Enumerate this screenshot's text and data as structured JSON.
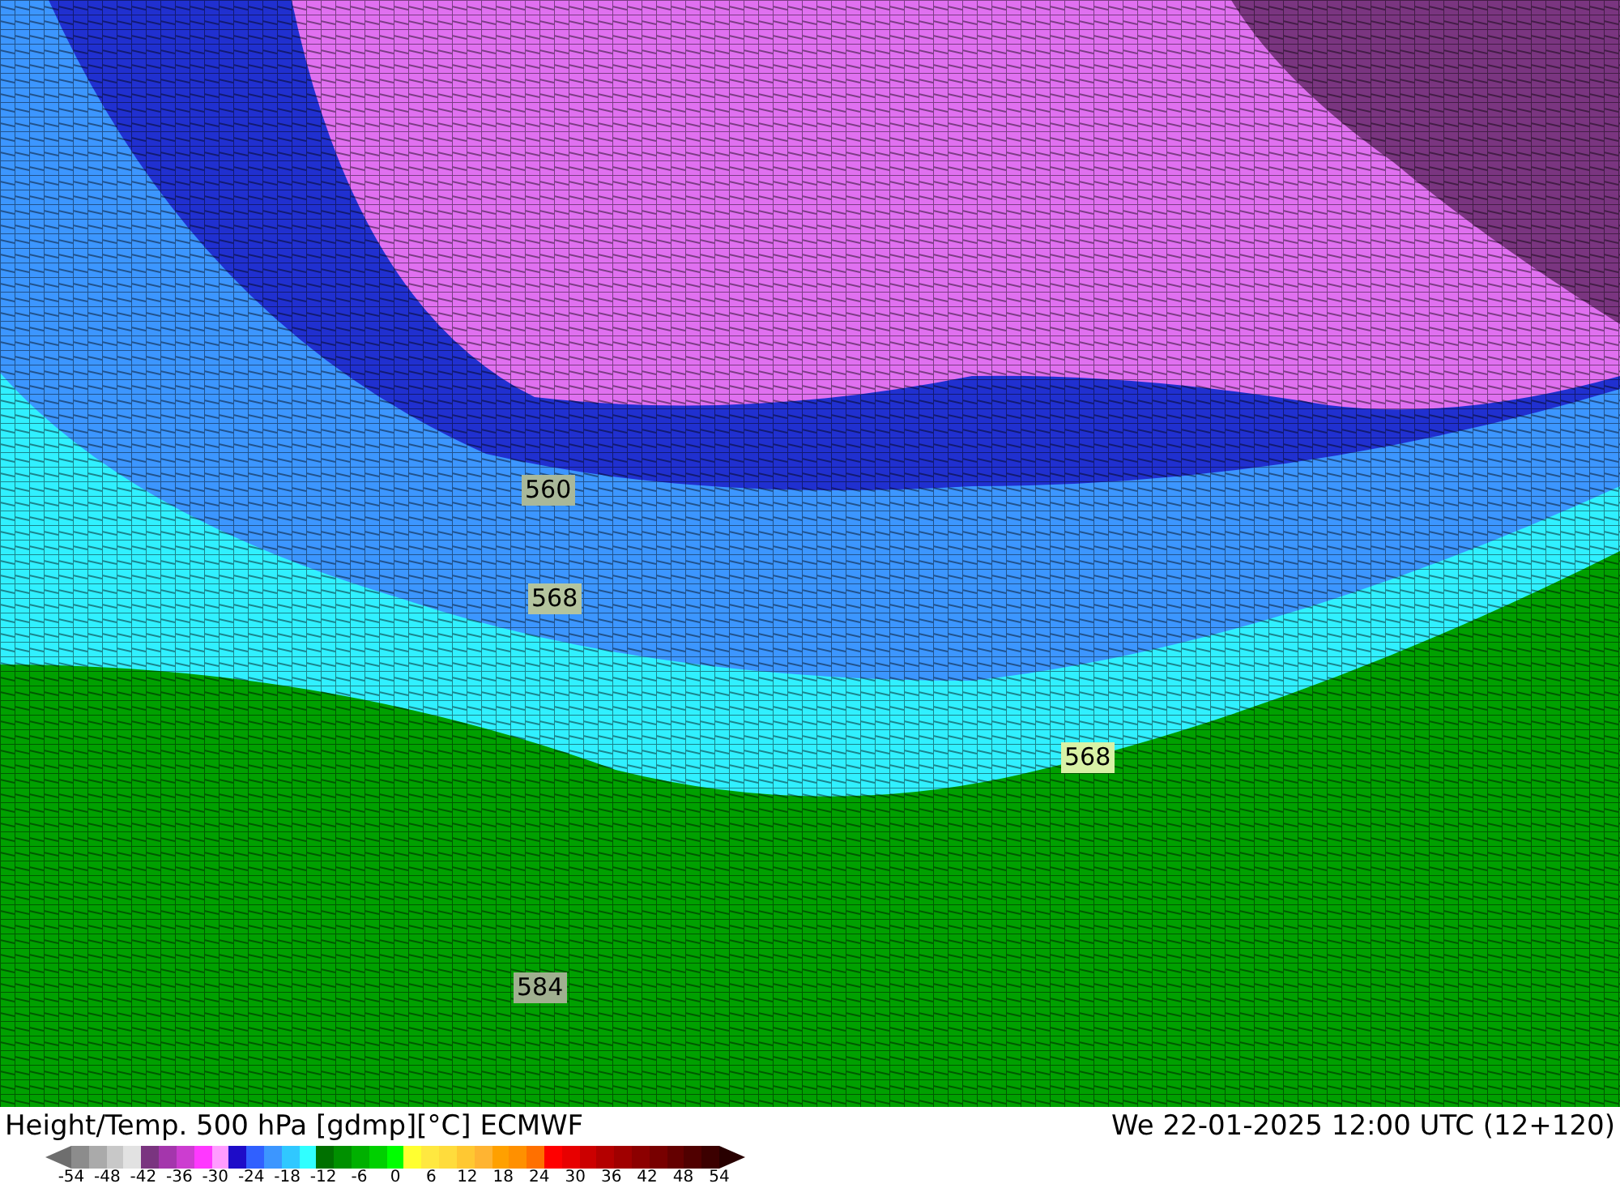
{
  "map": {
    "contour_labels": [
      {
        "text": "560",
        "color": "#a9b89a"
      },
      {
        "text": "568",
        "color": "#b4c49e"
      },
      {
        "text": "568",
        "color": "#d8f2a6"
      },
      {
        "text": "584",
        "color": "#a0b090"
      }
    ]
  },
  "title": "Height/Temp. 500 hPa [gdmp][°C] ECMWF",
  "datetime": "We 22-01-2025 12:00 UTC (12+120)",
  "legend": {
    "colors": [
      {
        "color": "#8c8c8c"
      },
      {
        "color": "#aaaaaa"
      },
      {
        "color": "#c8c8c8"
      },
      {
        "color": "#e2e2e2"
      },
      {
        "color": "#7a3580"
      },
      {
        "color": "#a436ac"
      },
      {
        "color": "#cc3dd0"
      },
      {
        "color": "#ff38ff"
      },
      {
        "color": "#ff9cff"
      },
      {
        "color": "#1e0cc8"
      },
      {
        "color": "#3060ff"
      },
      {
        "color": "#3c96ff"
      },
      {
        "color": "#30c8ff"
      },
      {
        "color": "#30ffff"
      },
      {
        "color": "#007000"
      },
      {
        "color": "#009000"
      },
      {
        "color": "#00b000"
      },
      {
        "color": "#00d000"
      },
      {
        "color": "#00ff00"
      },
      {
        "color": "#ffff30"
      },
      {
        "color": "#ffe840"
      },
      {
        "color": "#ffdc3c"
      },
      {
        "color": "#ffc832"
      },
      {
        "color": "#ffb432"
      },
      {
        "color": "#ffa000"
      },
      {
        "color": "#ff9000"
      },
      {
        "color": "#ff7000"
      },
      {
        "color": "#ff0000"
      },
      {
        "color": "#e80000"
      },
      {
        "color": "#cc0000"
      },
      {
        "color": "#b40000"
      },
      {
        "color": "#a00000"
      },
      {
        "color": "#8c0000"
      },
      {
        "color": "#780000"
      },
      {
        "color": "#640000"
      },
      {
        "color": "#500000"
      },
      {
        "color": "#3c0000"
      }
    ],
    "ticks": [
      "-54",
      "-48",
      "-42",
      "-36",
      "-30",
      "-24",
      "-18",
      "-12",
      "-6",
      "0",
      "6",
      "12",
      "18",
      "24",
      "30",
      "36",
      "42",
      "48",
      "54"
    ]
  }
}
